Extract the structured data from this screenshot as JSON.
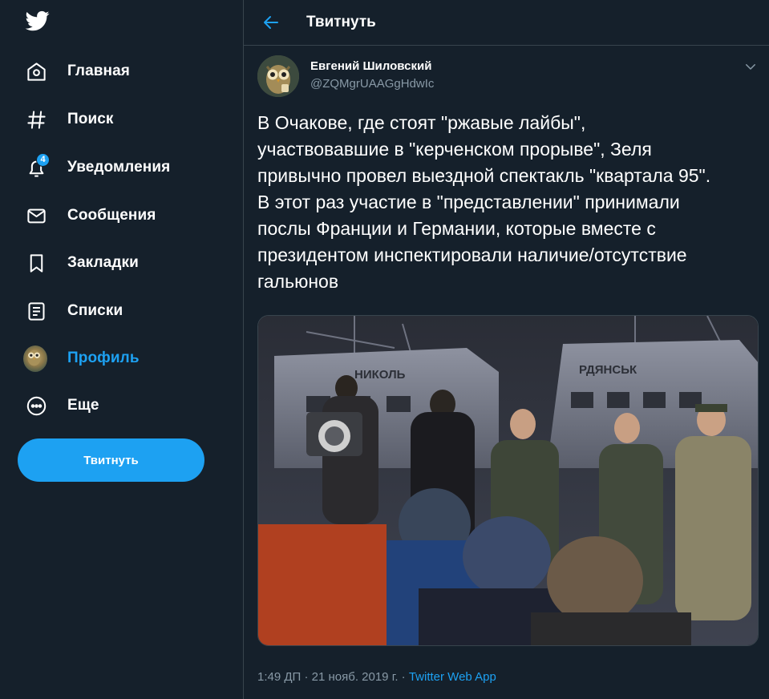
{
  "nav": {
    "items": [
      {
        "label": "Главная",
        "icon": "home-icon"
      },
      {
        "label": "Поиск",
        "icon": "hash-icon"
      },
      {
        "label": "Уведомления",
        "icon": "bell-icon",
        "badge": "4"
      },
      {
        "label": "Сообщения",
        "icon": "mail-icon"
      },
      {
        "label": "Закладки",
        "icon": "bookmark-icon"
      },
      {
        "label": "Списки",
        "icon": "list-icon"
      },
      {
        "label": "Профиль",
        "icon": "avatar",
        "active": true
      },
      {
        "label": "Еще",
        "icon": "more-icon"
      }
    ],
    "tweet_button": "Твитнуть"
  },
  "header": {
    "title": "Твитнуть"
  },
  "tweet": {
    "author_name": "Евгений Шиловский",
    "author_handle": "@ZQMgrUAAGgHdwIc",
    "text": "В Очакове, где стоят \"ржавые лайбы\",\nучаствовавшие в \"керченском прорыве\", Зеля\nпривычно провел выездной спектакль \"квартала 95\".\nВ этот раз участие в \"представлении\" принимали\nпослы Франции и Германии, которые вместе с\nпрезидентом инспектировали наличие/отсутствие\nгальюнов",
    "timestamp": "1:49 ДП · 21 нояб. 2019 г. · ",
    "source_app": "Twitter Web App",
    "media_text_1": "НИКОЛЬ",
    "media_text_2": "РДЯНСЬК"
  },
  "colors": {
    "background": "#15202b",
    "accent": "#1da1f2",
    "secondary_text": "#8899a6",
    "border": "#38444d"
  }
}
